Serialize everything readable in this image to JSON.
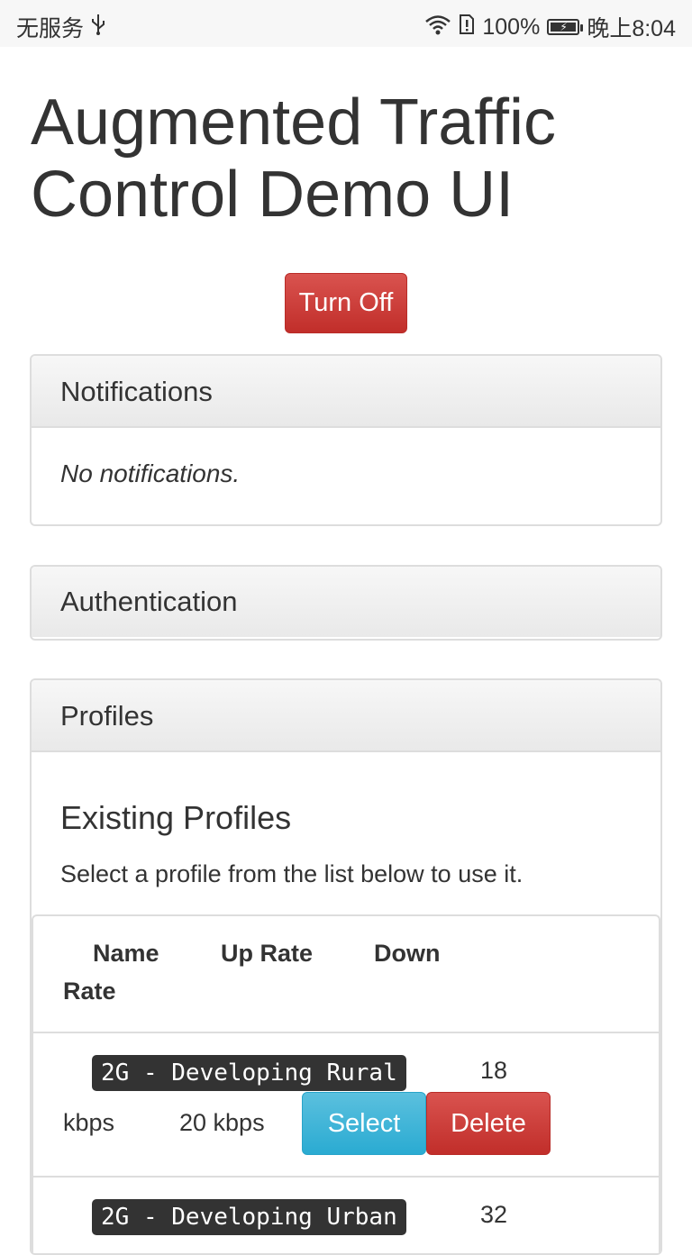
{
  "status_bar": {
    "carrier": "无服务",
    "usb_icon": "usb-icon",
    "wifi_icon": "wifi-icon",
    "sim_icon": "sim-alert-icon",
    "battery_percent": "100%",
    "battery_icon": "battery-charging-icon",
    "time": "晚上8:04"
  },
  "page": {
    "title": "Augmented Traffic Control Demo UI",
    "turn_off_label": "Turn Off"
  },
  "notifications": {
    "heading": "Notifications",
    "empty_text": "No notifications."
  },
  "authentication": {
    "heading": "Authentication"
  },
  "profiles": {
    "heading": "Profiles",
    "subheading": "Existing Profiles",
    "description": "Select a profile from the list below to use it.",
    "columns": {
      "name": "Name",
      "up_rate": "Up Rate",
      "down": "Down",
      "rate": "Rate"
    },
    "rows": [
      {
        "name": "2G - Developing Rural",
        "down_value": "18",
        "down_unit": "kbps",
        "up_rate": "20 kbps",
        "select_label": "Select",
        "delete_label": "Delete"
      },
      {
        "name": "2G - Developing Urban",
        "down_value": "32"
      }
    ]
  },
  "colors": {
    "danger": "#d9534f",
    "info": "#5bc0de",
    "label_dark": "#333333"
  }
}
